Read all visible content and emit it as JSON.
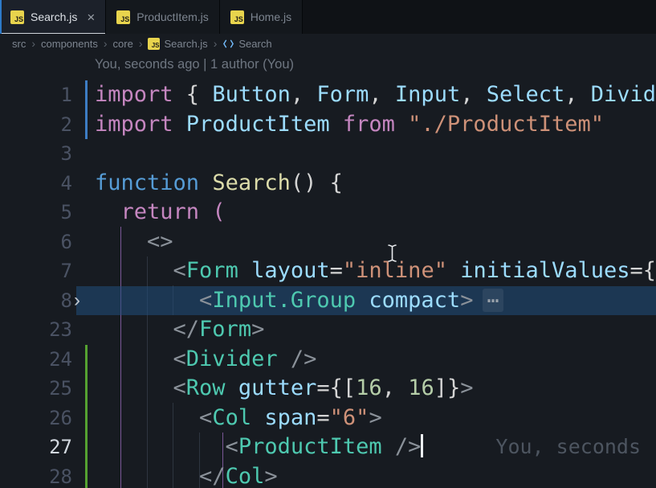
{
  "colors": {
    "editor_bg": "#171b21",
    "tabbar_bg": "#0f1216",
    "active_tab_bg": "#1c212a",
    "js_icon_bg": "#e8d44d",
    "git_modified": "#3d7dc4",
    "git_added": "#55a231",
    "fold_highlight": "#214e7c",
    "indent_guide_active": "#7a5796",
    "keyword": "#c586c0",
    "keyword_declaration": "#569cd6",
    "function_name": "#dcdcaa",
    "variable": "#9cdcfe",
    "string": "#ce9178",
    "jsx_tag": "#4ec9b0",
    "number": "#b5cea8",
    "blame_text": "#4d5560"
  },
  "icons": {
    "js_badge": "JS",
    "fold_chevron": "›"
  },
  "tabs": [
    {
      "label": "Search.js",
      "active": true,
      "close_label": "×"
    },
    {
      "label": "ProductItem.js",
      "active": false
    },
    {
      "label": "Home.js",
      "active": false
    }
  ],
  "breadcrumb": {
    "separator": "›",
    "items": [
      {
        "label": "src"
      },
      {
        "label": "components"
      },
      {
        "label": "core"
      },
      {
        "label": "Search.js",
        "icon": "js-icon"
      },
      {
        "label": "Search",
        "icon": "symbol-icon"
      }
    ]
  },
  "codelens": {
    "text": "You, seconds ago | 1 author (You)"
  },
  "editor": {
    "fold_badge": "⋯",
    "lines": [
      {
        "num": "1",
        "deco": "modified",
        "tokens": [
          {
            "c": "kw",
            "t": "import "
          },
          {
            "c": "pun",
            "t": "{ "
          },
          {
            "c": "var",
            "t": "Button"
          },
          {
            "c": "pun",
            "t": ", "
          },
          {
            "c": "var",
            "t": "Form"
          },
          {
            "c": "pun",
            "t": ", "
          },
          {
            "c": "var",
            "t": "Input"
          },
          {
            "c": "pun",
            "t": ", "
          },
          {
            "c": "var",
            "t": "Select"
          },
          {
            "c": "pun",
            "t": ", "
          },
          {
            "c": "var",
            "t": "Divider"
          }
        ]
      },
      {
        "num": "2",
        "deco": "modified",
        "tokens": [
          {
            "c": "kw",
            "t": "import "
          },
          {
            "c": "var",
            "t": "ProductItem"
          },
          {
            "c": "pun",
            "t": " "
          },
          {
            "c": "kw",
            "t": "from "
          },
          {
            "c": "str",
            "t": "\"./ProductItem\""
          }
        ]
      },
      {
        "num": "3",
        "tokens": []
      },
      {
        "num": "4",
        "tokens": [
          {
            "c": "kwb",
            "t": "function "
          },
          {
            "c": "fn",
            "t": "Search"
          },
          {
            "c": "pun",
            "t": "() {"
          }
        ]
      },
      {
        "num": "5",
        "tokens": [
          {
            "c": "pun",
            "t": "  "
          },
          {
            "c": "kw",
            "t": "return "
          },
          {
            "c": "kw",
            "t": "("
          }
        ]
      },
      {
        "num": "6",
        "tokens": [
          {
            "c": "brk",
            "t": "    <>"
          }
        ]
      },
      {
        "num": "7",
        "tokens": [
          {
            "c": "brk",
            "t": "      <"
          },
          {
            "c": "tag",
            "t": "Form"
          },
          {
            "c": "pun",
            "t": " "
          },
          {
            "c": "attr",
            "t": "layout"
          },
          {
            "c": "pun",
            "t": "="
          },
          {
            "c": "str",
            "t": "\"inline\""
          },
          {
            "c": "pun",
            "t": " "
          },
          {
            "c": "attr",
            "t": "initialValues"
          },
          {
            "c": "pun",
            "t": "={"
          }
        ]
      },
      {
        "num": "8",
        "fold": true,
        "highlighted": true,
        "tokens": [
          {
            "c": "brk",
            "t": "        <"
          },
          {
            "c": "tag",
            "t": "Input.Group"
          },
          {
            "c": "pun",
            "t": " "
          },
          {
            "c": "attr",
            "t": "compact"
          },
          {
            "c": "brk",
            "t": ">"
          }
        ]
      },
      {
        "num": "23",
        "tokens": [
          {
            "c": "brk",
            "t": "      </"
          },
          {
            "c": "tag",
            "t": "Form"
          },
          {
            "c": "brk",
            "t": ">"
          }
        ]
      },
      {
        "num": "24",
        "deco": "added",
        "tokens": [
          {
            "c": "brk",
            "t": "      <"
          },
          {
            "c": "tag",
            "t": "Divider"
          },
          {
            "c": "brk",
            "t": " />"
          }
        ]
      },
      {
        "num": "25",
        "deco": "added",
        "tokens": [
          {
            "c": "brk",
            "t": "      <"
          },
          {
            "c": "tag",
            "t": "Row"
          },
          {
            "c": "pun",
            "t": " "
          },
          {
            "c": "attr",
            "t": "gutter"
          },
          {
            "c": "pun",
            "t": "={["
          },
          {
            "c": "num",
            "t": "16"
          },
          {
            "c": "pun",
            "t": ", "
          },
          {
            "c": "num",
            "t": "16"
          },
          {
            "c": "pun",
            "t": "]}"
          },
          {
            "c": "brk",
            "t": ">"
          }
        ]
      },
      {
        "num": "26",
        "deco": "added",
        "tokens": [
          {
            "c": "brk",
            "t": "        <"
          },
          {
            "c": "tag",
            "t": "Col"
          },
          {
            "c": "pun",
            "t": " "
          },
          {
            "c": "attr",
            "t": "span"
          },
          {
            "c": "pun",
            "t": "="
          },
          {
            "c": "str",
            "t": "\"6\""
          },
          {
            "c": "brk",
            "t": ">"
          }
        ]
      },
      {
        "num": "27",
        "deco": "added",
        "active": true,
        "cursor": true,
        "blame": "You, seconds",
        "tokens": [
          {
            "c": "brk",
            "t": "          <"
          },
          {
            "c": "tag",
            "t": "ProductItem"
          },
          {
            "c": "brk",
            "t": " />"
          }
        ]
      },
      {
        "num": "28",
        "deco": "added",
        "tokens": [
          {
            "c": "brk",
            "t": "        </"
          },
          {
            "c": "tag",
            "t": "Col"
          },
          {
            "c": "brk",
            "t": ">"
          }
        ]
      }
    ]
  }
}
